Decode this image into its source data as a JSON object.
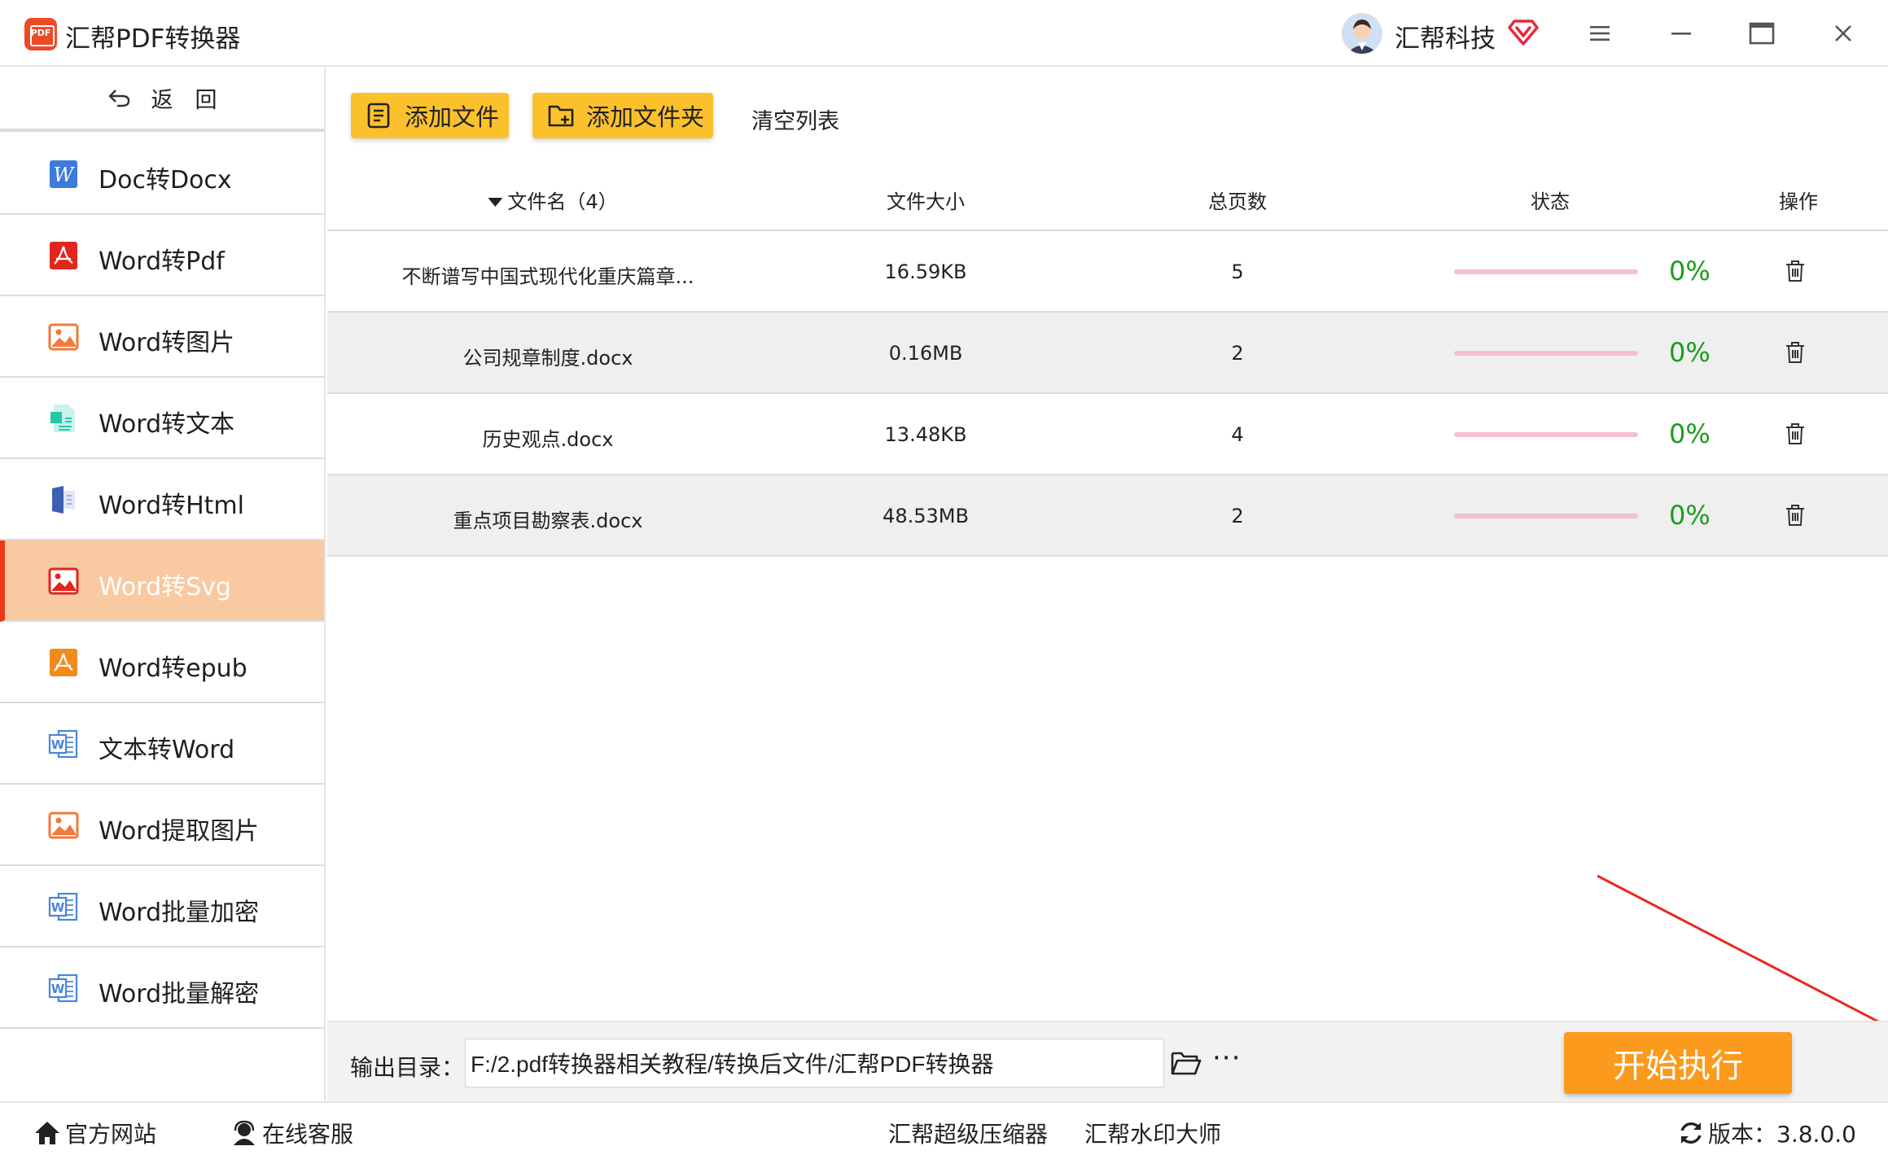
{
  "app": {
    "title": "汇帮PDF转换器",
    "logo_text": "PDF"
  },
  "user": {
    "name": "汇帮科技"
  },
  "sidebar": {
    "back_label": "返　回",
    "items": [
      {
        "label": "Doc转Docx",
        "icon": "word-w-icon"
      },
      {
        "label": "Word转Pdf",
        "icon": "pdf-icon"
      },
      {
        "label": "Word转图片",
        "icon": "image-icon"
      },
      {
        "label": "Word转文本",
        "icon": "text-doc-icon"
      },
      {
        "label": "Word转Html",
        "icon": "html-icon"
      },
      {
        "label": "Word转Svg",
        "icon": "svg-image-icon",
        "active": true
      },
      {
        "label": "Word转epub",
        "icon": "epub-icon"
      },
      {
        "label": "文本转Word",
        "icon": "word-doc-icon"
      },
      {
        "label": "Word提取图片",
        "icon": "image-icon"
      },
      {
        "label": "Word批量加密",
        "icon": "word-doc-icon"
      },
      {
        "label": "Word批量解密",
        "icon": "word-doc-icon"
      }
    ]
  },
  "toolbar": {
    "add_file": "添加文件",
    "add_folder": "添加文件夹",
    "clear_list": "清空列表"
  },
  "table": {
    "headers": {
      "name": "文件名（4）",
      "size": "文件大小",
      "pages": "总页数",
      "status": "状态",
      "action": "操作"
    },
    "rows": [
      {
        "name": "不断谱写中国式现代化重庆篇章...",
        "size": "16.59KB",
        "pages": "5",
        "status": "0%",
        "progress": 0
      },
      {
        "name": "公司规章制度.docx",
        "size": "0.16MB",
        "pages": "2",
        "status": "0%",
        "progress": 0
      },
      {
        "name": "历史观点.docx",
        "size": "13.48KB",
        "pages": "4",
        "status": "0%",
        "progress": 0
      },
      {
        "name": "重点项目勘察表.docx",
        "size": "48.53MB",
        "pages": "2",
        "status": "0%",
        "progress": 0
      }
    ]
  },
  "output": {
    "label": "输出目录：",
    "path": "F:/2.pdf转换器相关教程/转换后文件/汇帮PDF转换器",
    "more": "···"
  },
  "start_button": "开始执行",
  "footer": {
    "website": "官方网站",
    "support": "在线客服",
    "compressor": "汇帮超级压缩器",
    "watermark": "汇帮水印大师",
    "version": "版本：3.8.0.0"
  },
  "colors": {
    "accent_yellow": "#fbc12c",
    "start_orange": "#fb9a1c",
    "active_item": "#f9c9a2",
    "active_border": "#e83a1a",
    "progress_track": "#f4c0cc",
    "status_green": "#1a9e1a",
    "annotation_red": "#e82a20"
  }
}
